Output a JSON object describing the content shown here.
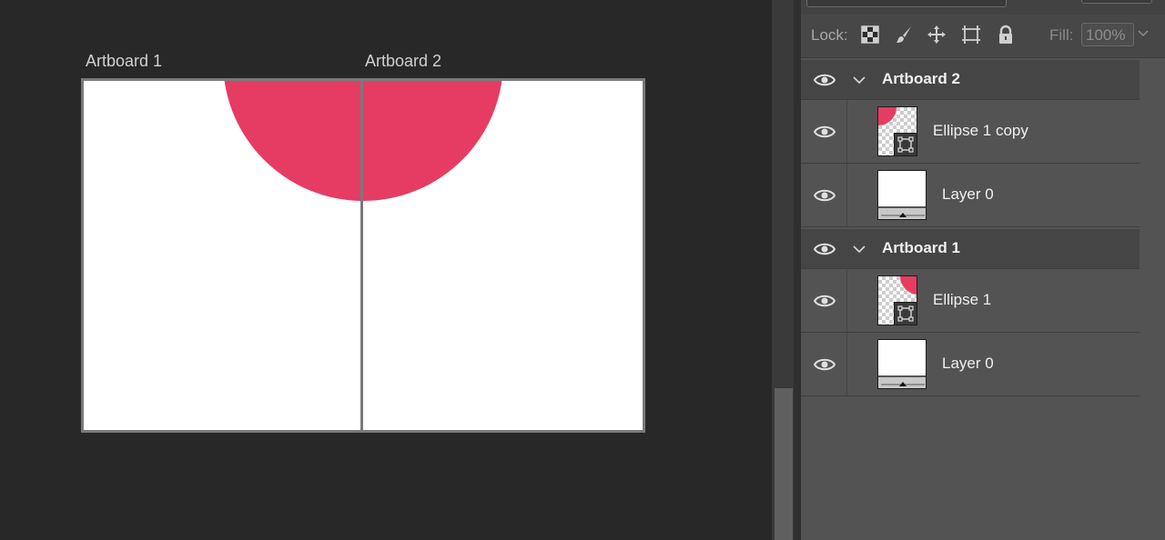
{
  "canvas": {
    "artboards": [
      {
        "title": "Artboard 1"
      },
      {
        "title": "Artboard 2"
      }
    ],
    "ellipse_color": "#e63c63"
  },
  "panel": {
    "lock_label": "Lock:",
    "lock_icons": [
      "lock-transparent-pixels-icon",
      "lock-image-pixels-icon",
      "lock-position-icon",
      "lock-artboard-icon",
      "lock-all-icon"
    ],
    "fill_label": "Fill:",
    "fill_value": "100%",
    "groups": [
      {
        "name": "Artboard 2",
        "layers": [
          {
            "name": "Ellipse 1 copy",
            "kind": "shape"
          },
          {
            "name": "Layer 0",
            "kind": "pixel"
          }
        ]
      },
      {
        "name": "Artboard 1",
        "layers": [
          {
            "name": "Ellipse 1",
            "kind": "shape"
          },
          {
            "name": "Layer 0",
            "kind": "pixel"
          }
        ]
      }
    ]
  }
}
